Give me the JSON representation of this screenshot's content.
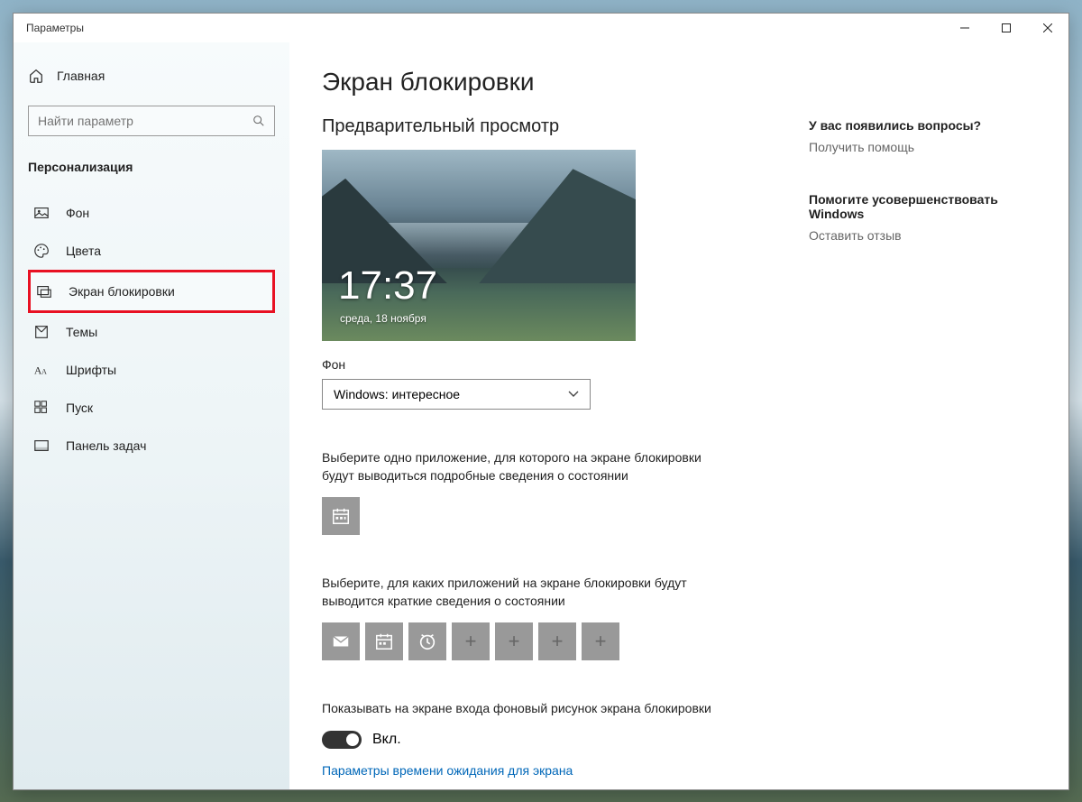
{
  "window_title": "Параметры",
  "sidebar": {
    "home": "Главная",
    "search_placeholder": "Найти параметр",
    "section": "Персонализация",
    "items": [
      {
        "label": "Фон"
      },
      {
        "label": "Цвета"
      },
      {
        "label": "Экран блокировки"
      },
      {
        "label": "Темы"
      },
      {
        "label": "Шрифты"
      },
      {
        "label": "Пуск"
      },
      {
        "label": "Панель задач"
      }
    ]
  },
  "main": {
    "title": "Экран блокировки",
    "preview_label": "Предварительный просмотр",
    "preview_time": "17:37",
    "preview_date": "среда, 18 ноября",
    "bg_label": "Фон",
    "bg_value": "Windows: интересное",
    "detailed_label": "Выберите одно приложение, для которого на экране блокировки будут выводиться подробные сведения о состоянии",
    "quick_label": "Выберите, для каких приложений на экране блокировки будут выводится краткие сведения о состоянии",
    "show_bg_label": "Показывать на экране входа фоновый рисунок экрана блокировки",
    "toggle_state": "Вкл.",
    "timeout_label": "Параметры времени ожидания для экрана"
  },
  "right": {
    "q_head": "У вас появились вопросы?",
    "q_link": "Получить помощь",
    "fb_head": "Помогите усовершенствовать Windows",
    "fb_link": "Оставить отзыв"
  }
}
